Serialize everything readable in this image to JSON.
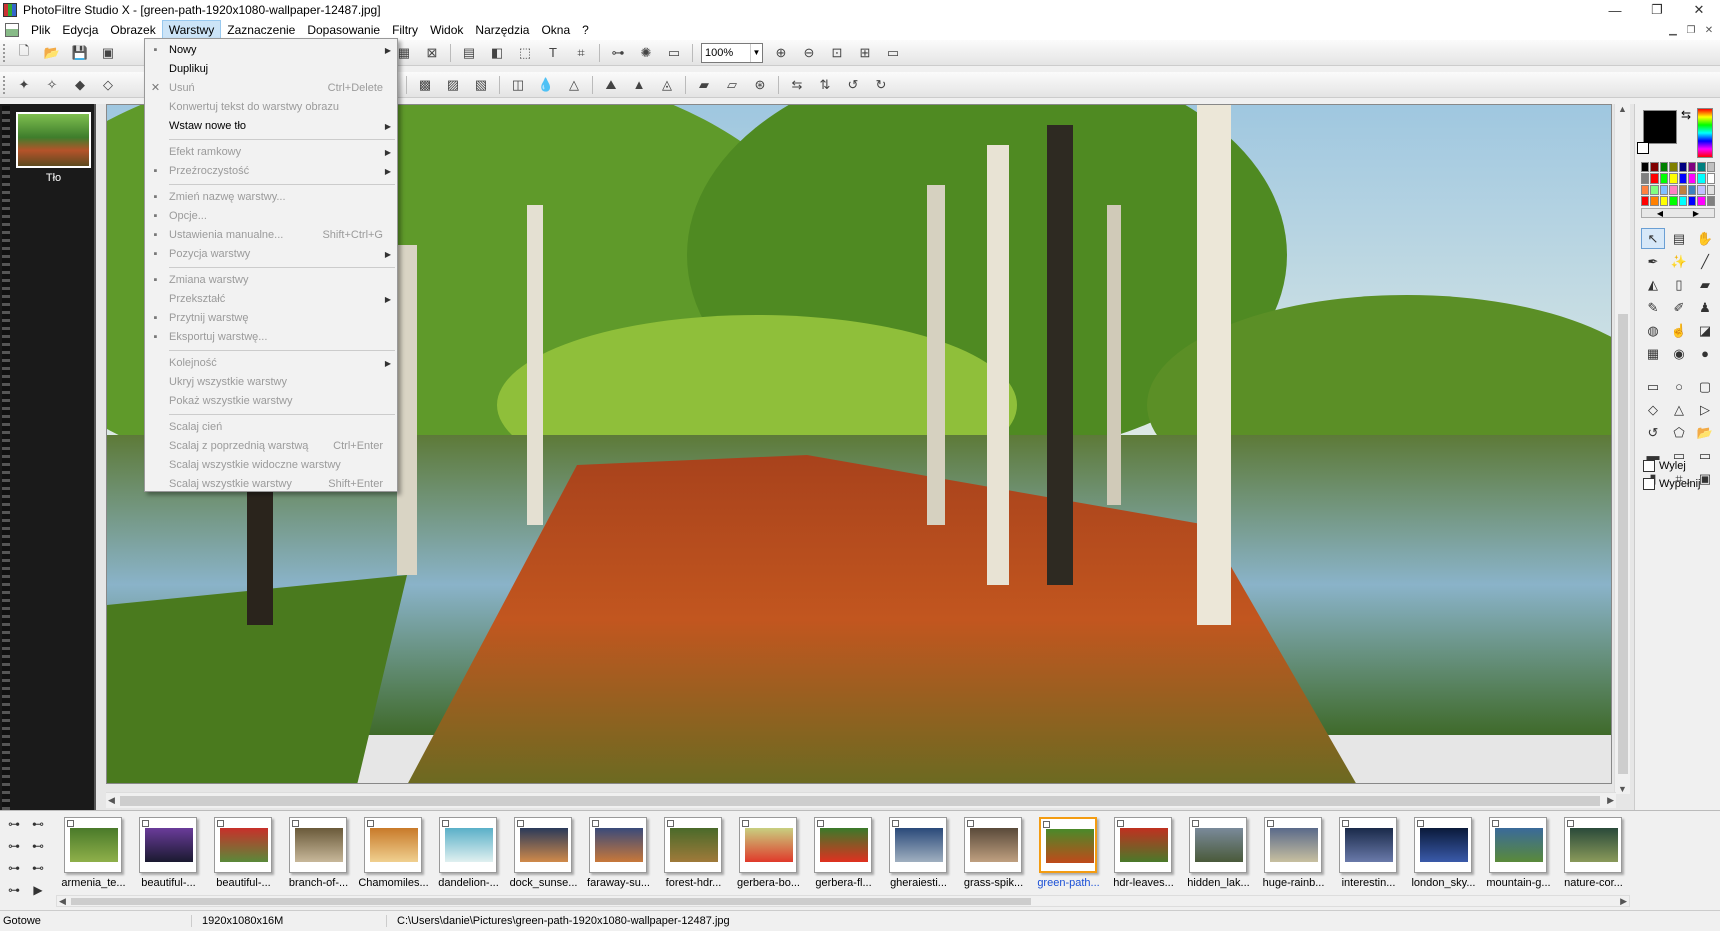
{
  "window": {
    "title": "PhotoFiltre Studio X - [green-path-1920x1080-wallpaper-12487.jpg]",
    "minimize": "—",
    "maximize": "❐",
    "close": "✕"
  },
  "menu": {
    "items": [
      "Plik",
      "Edycja",
      "Obrazek",
      "Warstwy",
      "Zaznaczenie",
      "Dopasowanie",
      "Filtry",
      "Widok",
      "Narzędzia",
      "Okna",
      "?"
    ],
    "active": "Warstwy"
  },
  "toolbar": {
    "zoom": "100%"
  },
  "layers": {
    "name": "Tło"
  },
  "dropdown": {
    "items": [
      {
        "label": "Nowy",
        "enabled": true,
        "submenu": true,
        "icon": "new-layer-icon"
      },
      {
        "label": "Duplikuj",
        "enabled": true
      },
      {
        "label": "Usuń",
        "enabled": false,
        "shortcut": "Ctrl+Delete",
        "icon": "delete-icon"
      },
      {
        "label": "Konwertuj tekst do warstwy obrazu",
        "enabled": false
      },
      {
        "label": "Wstaw nowe tło",
        "enabled": true,
        "submenu": true
      },
      {
        "sep": true
      },
      {
        "label": "Efekt ramkowy",
        "enabled": false,
        "submenu": true
      },
      {
        "label": "Przeźroczystość",
        "enabled": false,
        "submenu": true,
        "icon": "transparency-icon"
      },
      {
        "sep": true
      },
      {
        "label": "Zmień nazwę warstwy...",
        "enabled": false,
        "icon": "rename-icon"
      },
      {
        "label": "Opcje...",
        "enabled": false,
        "icon": "options-icon"
      },
      {
        "label": "Ustawienia manualne...",
        "enabled": false,
        "shortcut": "Shift+Ctrl+G",
        "icon": "manual-settings-icon"
      },
      {
        "label": "Pozycja warstwy",
        "enabled": false,
        "submenu": true,
        "icon": "position-icon"
      },
      {
        "sep": true
      },
      {
        "label": "Zmiana warstwy",
        "enabled": false,
        "icon": "change-layer-icon"
      },
      {
        "label": "Przekształć",
        "enabled": false,
        "submenu": true
      },
      {
        "label": "Przytnij warstwę",
        "enabled": false,
        "icon": "crop-layer-icon"
      },
      {
        "label": "Eksportuj warstwę...",
        "enabled": false,
        "icon": "export-icon"
      },
      {
        "sep": true
      },
      {
        "label": "Kolejność",
        "enabled": false,
        "submenu": true
      },
      {
        "label": "Ukryj wszystkie warstwy",
        "enabled": false
      },
      {
        "label": "Pokaż wszystkie warstwy",
        "enabled": false
      },
      {
        "sep": true
      },
      {
        "label": "Scalaj cień",
        "enabled": false
      },
      {
        "label": "Scalaj z poprzednią warstwą",
        "enabled": false,
        "shortcut": "Ctrl+Enter"
      },
      {
        "label": "Scalaj wszystkie widoczne warstwy",
        "enabled": false
      },
      {
        "label": "Scalaj wszystkie warstwy",
        "enabled": false,
        "shortcut": "Shift+Enter"
      }
    ]
  },
  "options": {
    "fill_out": "Wylej",
    "fill": "Wypełnij"
  },
  "filmstrip": {
    "items": [
      "armenia_te...",
      "beautiful-...",
      "beautiful-...",
      "branch-of-...",
      "Chamomiles...",
      "dandelion-...",
      "dock_sunse...",
      "faraway-su...",
      "forest-hdr...",
      "gerbera-bo...",
      "gerbera-fl...",
      "gheraiesti...",
      "grass-spik...",
      "green-path...",
      "hdr-leaves...",
      "hidden_lak...",
      "huge-rainb...",
      "interestin...",
      "london_sky...",
      "mountain-g...",
      "nature-cor..."
    ],
    "selected_index": 13
  },
  "status": {
    "ready": "Gotowe",
    "info": "1920x1080x16M",
    "path": "C:\\Users\\danie\\Pictures\\green-path-1920x1080-wallpaper-12487.jpg"
  },
  "colors": {
    "foreground": "#000000",
    "background": "#ffffff",
    "selection": "#f39c12"
  }
}
